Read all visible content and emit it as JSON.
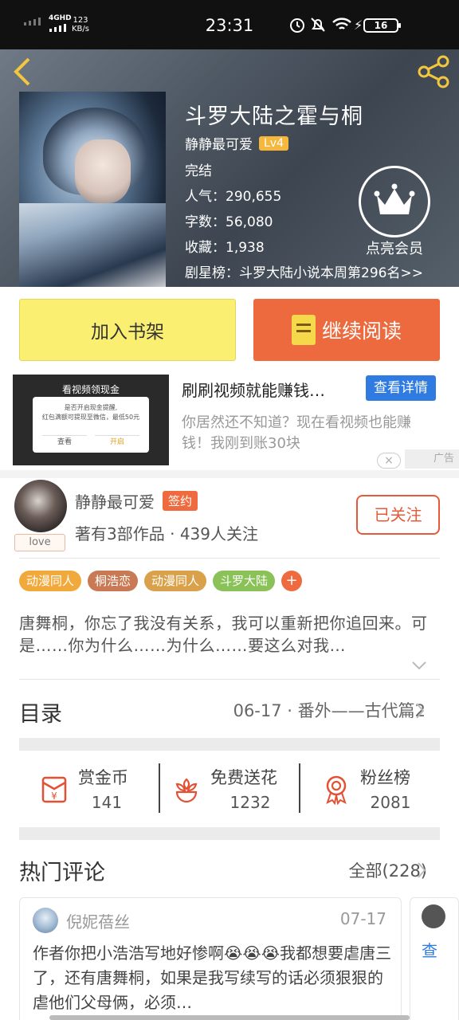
{
  "status_bar": {
    "network": "4GHD",
    "speed": "123",
    "speed_unit": "KB/s",
    "time": "23:31",
    "battery": "16"
  },
  "book": {
    "title": "斗罗大陆之霍与桐",
    "author": "静静最可爱",
    "level": "Lv4",
    "status": "完结",
    "popularity_label": "人气：",
    "popularity": "290,655",
    "words_label": "字数：",
    "words": "56,080",
    "favorites_label": "收藏：",
    "favorites": "1,938",
    "rank_label": "剧星榜：",
    "rank": "斗罗大陆小说本周第296名>>",
    "vip_label": "点亮会员"
  },
  "actions": {
    "add_shelf": "加入书架",
    "continue_reading": "继续阅读"
  },
  "ad": {
    "image_title": "看视频领现金",
    "image_text_1": "是否开启现金提醒,",
    "image_text_2": "红包满额可提现至微信，最低50元",
    "image_btn_view": "查看",
    "image_btn_open": "开启",
    "title": "刷刷视频就能赚钱…",
    "detail_button": "查看详情",
    "description": "你居然还不知道？现在看视频也能赚钱！我刚到账30块",
    "close": "×",
    "label": "广告"
  },
  "author_card": {
    "name": "静静最可爱",
    "badge": "签约",
    "love_tag": "love",
    "works": "著有3部作品",
    "dot": " · ",
    "followers": "439人关注",
    "follow_button": "已关注"
  },
  "tags": [
    {
      "label": "动漫同人",
      "color": "#f2a93b"
    },
    {
      "label": "桐浩恋",
      "color": "#c97a55"
    },
    {
      "label": "动漫同人",
      "color": "#d9a14a"
    },
    {
      "label": "斗罗大陆",
      "color": "#8ac257"
    },
    {
      "label": "+",
      "color": "#ef6b3f"
    }
  ],
  "description": "唐舞桐，你忘了我没有关系，我可以重新把你追回来。可是……你为什么……为什么……要这么对我…",
  "toc": {
    "label": "目录",
    "latest": "06-17 · 番外——古代篇2"
  },
  "stats": [
    {
      "label": "赏金币",
      "value": "141",
      "icon": "red-envelope-icon"
    },
    {
      "label": "免费送花",
      "value": "1232",
      "icon": "flower-icon"
    },
    {
      "label": "粉丝榜",
      "value": "2081",
      "icon": "medal-icon"
    }
  ],
  "comments": {
    "label": "热门评论",
    "all_label": "全部(228)",
    "items": [
      {
        "user": "倪妮蓓丝",
        "date": "07-17",
        "text": "作者你把小浩浩写地好惨啊😭😭😭我都想要虐唐三了，还有唐舞桐，如果是我写续写的话必须狠狠的虐他们父母俩，必须…"
      }
    ],
    "next_preview": "查"
  },
  "colors": {
    "accent_orange": "#ec6a3d",
    "shelf_yellow": "#fbef72",
    "link_blue": "#2f7be2",
    "back_arrow": "#f3c73d"
  }
}
